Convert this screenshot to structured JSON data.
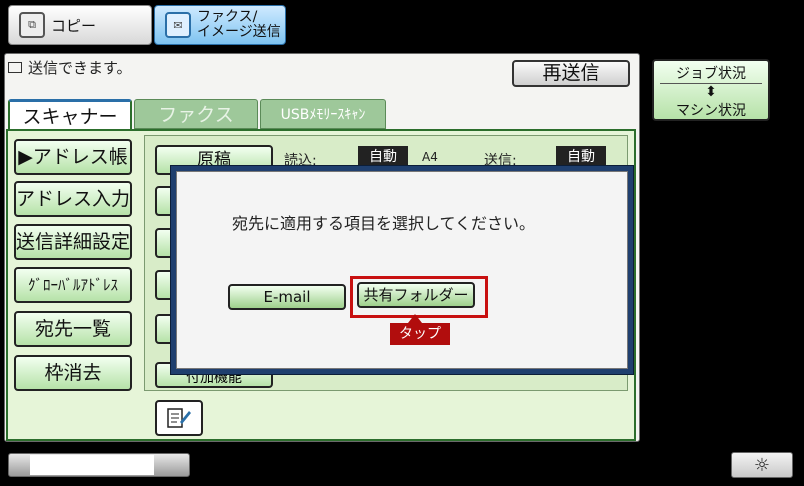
{
  "mode_tabs": {
    "copy_label": "コピー",
    "fax_line1": "ファクス/",
    "fax_line2": "イメージ送信"
  },
  "status": {
    "message": "送信できます。",
    "resend_label": "再送信"
  },
  "tabs": {
    "scanner": "スキャナー",
    "fax": "ファクス",
    "usb": "USBﾒﾓﾘｰｽｷｬﾝ"
  },
  "sidebar": {
    "items": [
      {
        "label": "▶アドレス帳"
      },
      {
        "label": "アドレス入力"
      },
      {
        "label": "送信詳細設定"
      },
      {
        "label": "ｸﾞﾛｰﾊﾞﾙｱﾄﾞﾚｽ"
      },
      {
        "label": "宛先一覧"
      },
      {
        "label": "枠消去"
      }
    ]
  },
  "settings": {
    "original_label": "原稿",
    "read_label": "読込:",
    "read_value": "自動",
    "paper_size": "A4",
    "send_label": "送信:",
    "send_value": "自動",
    "addon_label": "付加機能"
  },
  "job_status": {
    "top": "ジョブ状況",
    "arrow": "⬍",
    "bottom": "マシン状況"
  },
  "dialog": {
    "message": "宛先に適用する項目を選択してください。",
    "email_label": "E-mail",
    "shared_folder_label": "共有フォルダー",
    "tap_label": "タップ"
  },
  "bottom": {
    "brightness_icon": "☼"
  },
  "colors": {
    "accent_red": "#c81010",
    "dialog_frame": "#1f3f6e",
    "panel_green": "#e6f5d8"
  }
}
